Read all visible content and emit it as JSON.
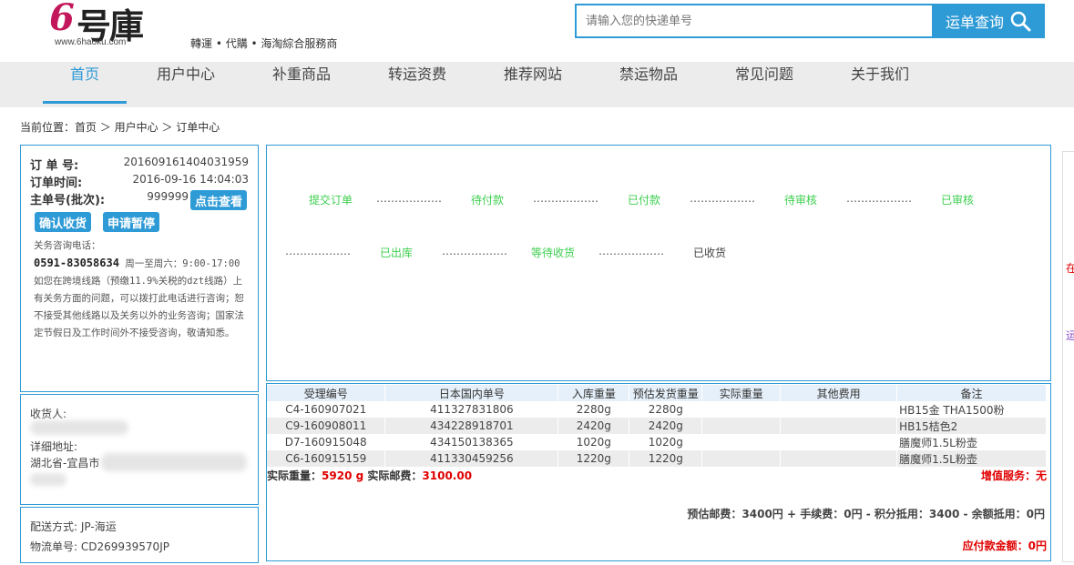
{
  "brand": {
    "logo_six": "6",
    "logo_chars": "号庫",
    "logo_url": "www.6haoku.com",
    "slogan": "轉運 • 代購 • 海淘綜合服務商",
    "accent_color": "#2e9ad6"
  },
  "search": {
    "placeholder": "请输入您的快递单号",
    "button_label": "运单查询",
    "icon": "search-icon"
  },
  "nav": {
    "items": [
      "首页",
      "用户中心",
      "补重商品",
      "转运资费",
      "推荐网站",
      "禁运物品",
      "常见问题",
      "关于我们"
    ],
    "active_index": 0
  },
  "breadcrumb": "当前位置：首页 ＞ 用户中心 ＞ 订单中心",
  "order": {
    "order_no_label": "订 单 号:",
    "order_no": "20160916140403195​9",
    "order_time_label": "订单时间:",
    "order_time": "2016-09-16 14:04:03",
    "master_no_label": "主单号(批次):",
    "master_no": "999999",
    "view_button": "点击查看",
    "confirm_button": "确认收货",
    "pause_button": "申请暂停"
  },
  "customs": {
    "line1": "关务咨询电话：",
    "phone": "0591-83058634",
    "hours": "周一至周六：9:00-17:00",
    "body": "如您在跨境线路（预缴11.9%关税的dzt线路）上有关务方面的问题，可以拨打此电话进行咨询；恕不接受其他线路以及关务以外的业务咨询；国家法定节假日及工作时间外不接受咨询，敬请知悉。"
  },
  "address": {
    "receiver_label": "收货人:",
    "detail_label": "详细地址:",
    "detail_value": "湖北省-宜昌市"
  },
  "shipping": {
    "method": "配送方式: JP-海运",
    "tracking": "物流单号: CD269939570JP"
  },
  "progress": {
    "row1": [
      "提交订单",
      "待付款",
      "已付款",
      "待审核",
      "已审核"
    ],
    "row2": [
      "已出库",
      "等待收货",
      "已收货"
    ],
    "dots": "………………",
    "active_color": "#3ccf4e"
  },
  "table": {
    "headers": [
      "受理编号",
      "日本国内单号",
      "入库重量",
      "预估发货重量",
      "实际重量",
      "其他费用",
      "备注"
    ],
    "rows": [
      [
        "C4-160907021",
        "411327831806",
        "2280g",
        "2280g",
        "",
        "",
        "HB15金 THA1500粉"
      ],
      [
        "C9-160908011",
        "434228918701",
        "2420g",
        "2420g",
        "",
        "",
        "HB15桔色2"
      ],
      [
        "D7-160915048",
        "434150138365",
        "1020g",
        "1020g",
        "",
        "",
        "膳魔师1.5L粉壶"
      ],
      [
        "C6-160915159",
        "411330459256",
        "1220g",
        "1220g",
        "",
        "",
        "膳魔师1.5L粉壶"
      ]
    ]
  },
  "summary": {
    "weight_label": "实际重量：",
    "weight_value": "5920 g",
    "postage_label": "实际邮费：",
    "postage_value": "3100.00",
    "value_added": "增值服务：无",
    "fee_line": "预估邮费：3400円 + 手续费：0円 - 积分抵用：3400 - 余额抵用：0円",
    "pay_line": "应付款金额：0円"
  },
  "edge": {
    "char1": "在",
    "char2": "运"
  }
}
